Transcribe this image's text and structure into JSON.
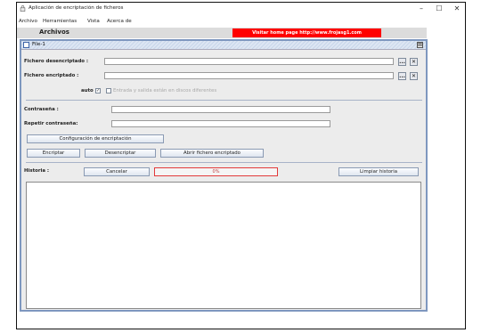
{
  "window": {
    "title": "Aplicación de encriptación de ficheros",
    "minimize": "–",
    "maximize": "☐",
    "close": "✕",
    "icon": "lock-icon"
  },
  "menu": [
    "Archivo",
    "Herramientas",
    "Vista",
    "Acerca de"
  ],
  "archivos": {
    "label": "Archivos",
    "link": "Visitar home page http://www.frojasg1.com"
  },
  "internal_frame": {
    "title": "File-1",
    "close": "⊠"
  },
  "files": {
    "decrypted_label": "Fichero desencriptado :",
    "decrypted_value": "",
    "encrypted_label": "Fichero encriptado :",
    "encrypted_value": "",
    "browse": "...",
    "clear": "✕"
  },
  "auto": {
    "label": "auto",
    "checked": "✓",
    "different_disks_label": "Entrada y salida están en discos diferentes"
  },
  "password": {
    "label": "Contraseña :",
    "repeat_label": "Repetir contraseña:"
  },
  "buttons": {
    "config": "Configuración de encriptación",
    "encrypt": "Encriptar",
    "decrypt": "Desencriptar",
    "open_encrypted": "Abrir fichero encriptado",
    "cancel": "Cancelar",
    "clear_history": "Limpiar historia"
  },
  "history": {
    "label": "Historia :",
    "progress_text": "0%",
    "progress": 0
  }
}
